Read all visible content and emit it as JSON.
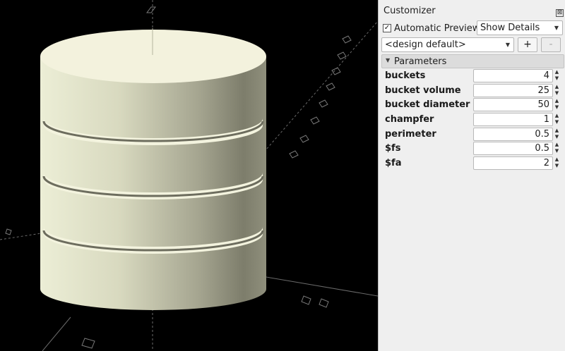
{
  "customizer": {
    "title": "Customizer",
    "close_glyph": "⊠",
    "auto_preview_label": "Automatic Preview",
    "auto_preview_checked": true,
    "detail_mode": "Show Details",
    "preset": "<design default>",
    "add_label": "+",
    "remove_label": "-",
    "section_label": "Parameters"
  },
  "parameters": [
    {
      "label": "buckets",
      "value": "4"
    },
    {
      "label": "bucket volume",
      "value": "25"
    },
    {
      "label": "bucket diameter",
      "value": "50"
    },
    {
      "label": "champfer",
      "value": "1"
    },
    {
      "label": "perimeter",
      "value": "0.5"
    },
    {
      "label": "$fs",
      "value": "0.5"
    },
    {
      "label": "$fa",
      "value": "2"
    }
  ],
  "viewport": {
    "background": "#000000",
    "model_color": "#f2f1d8",
    "model_shadow": "#8a8a76",
    "icons": [
      "stacked-buckets-cylinder",
      "axis-tick-marks"
    ]
  }
}
